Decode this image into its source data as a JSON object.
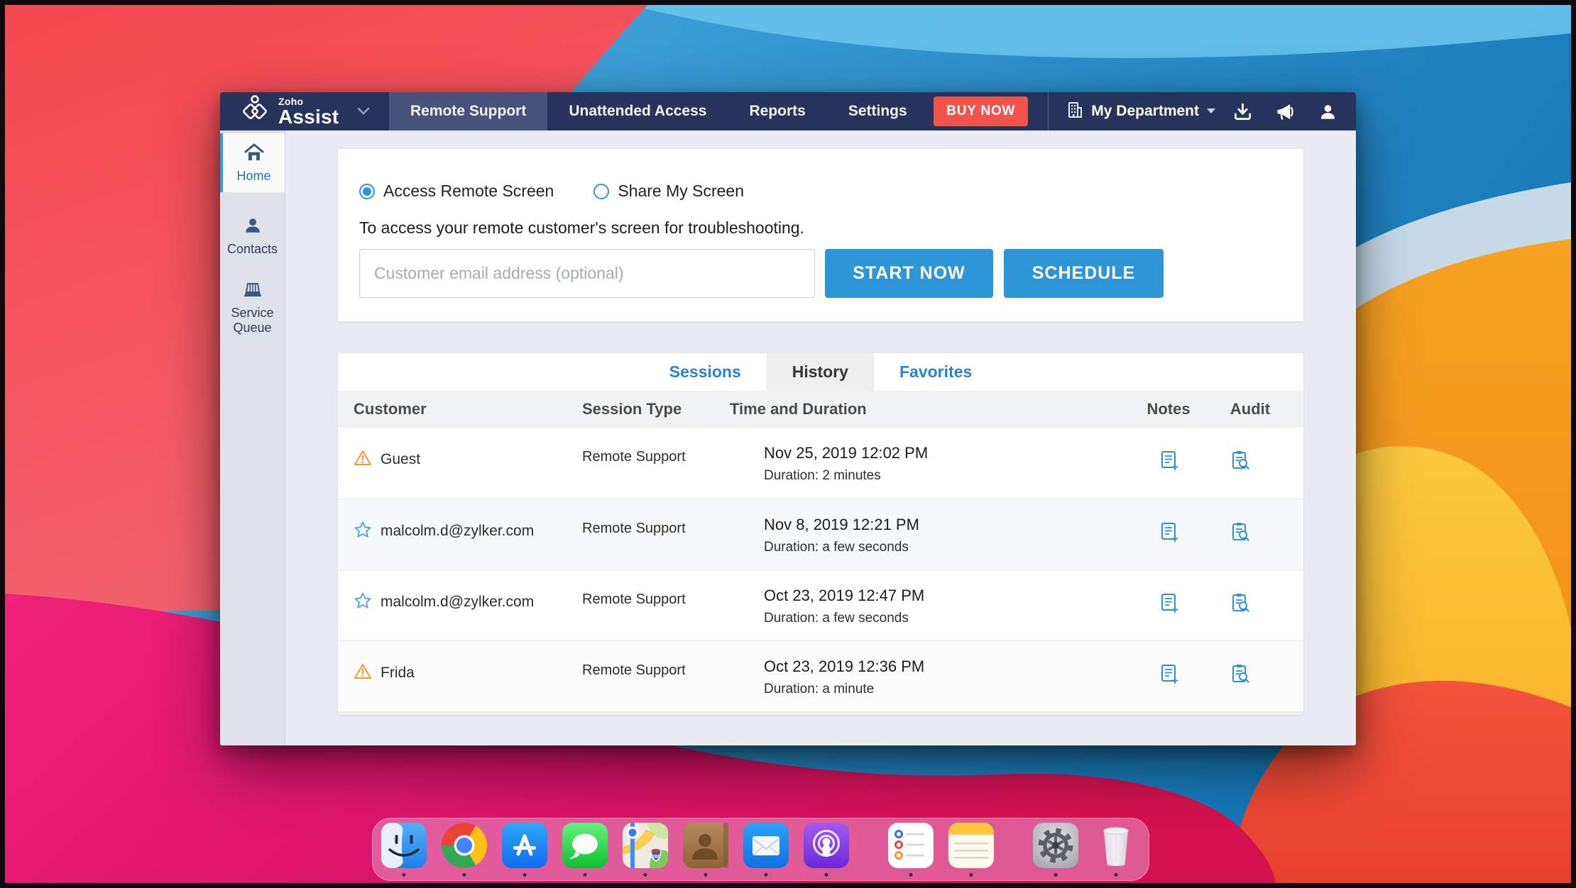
{
  "window": {
    "nav": {
      "brand": {
        "top": "Zoho",
        "bottom": "Assist"
      },
      "tabs": [
        {
          "label": "Remote Support",
          "active": true
        },
        {
          "label": "Unattended Access",
          "active": false
        },
        {
          "label": "Reports",
          "active": false
        },
        {
          "label": "Settings",
          "active": false
        }
      ],
      "buy_now": "BUY NOW",
      "department": "My Department"
    },
    "sidebar": {
      "items": [
        {
          "label": "Home",
          "active": true
        },
        {
          "label": "Contacts",
          "active": false
        },
        {
          "label": "Service Queue",
          "active": false
        }
      ]
    },
    "session_panel": {
      "radios": [
        {
          "label": "Access Remote Screen",
          "selected": true
        },
        {
          "label": "Share My Screen",
          "selected": false
        }
      ],
      "description": "To access your remote customer's screen for troubleshooting.",
      "email_placeholder": "Customer email address (optional)",
      "start_button": "START NOW",
      "schedule_button": "SCHEDULE"
    },
    "history_panel": {
      "tabs": [
        {
          "label": "Sessions",
          "active": false
        },
        {
          "label": "History",
          "active": true
        },
        {
          "label": "Favorites",
          "active": false
        }
      ],
      "columns": [
        "Customer",
        "Session Type",
        "Time and Duration",
        "Notes",
        "Audit"
      ],
      "rows": [
        {
          "status_icon": "warning-icon",
          "customer": "Guest",
          "session_type": "Remote Support",
          "time": "Nov 25, 2019 12:02 PM",
          "duration": "Duration: 2 minutes"
        },
        {
          "status_icon": "star-icon",
          "customer": "malcolm.d@zylker.com",
          "session_type": "Remote Support",
          "time": "Nov 8, 2019 12:21 PM",
          "duration": "Duration: a few seconds"
        },
        {
          "status_icon": "star-icon",
          "customer": "malcolm.d@zylker.com",
          "session_type": "Remote Support",
          "time": "Oct 23, 2019 12:47 PM",
          "duration": "Duration: a few seconds"
        },
        {
          "status_icon": "warning-icon",
          "customer": "Frida",
          "session_type": "Remote Support",
          "time": "Oct 23, 2019 12:36 PM",
          "duration": "Duration: a minute"
        }
      ]
    }
  },
  "dock": {
    "apps": [
      {
        "name": "finder-icon"
      },
      {
        "name": "chrome-icon"
      },
      {
        "name": "app-store-icon"
      },
      {
        "name": "messages-icon"
      },
      {
        "name": "maps-icon"
      },
      {
        "name": "contacts-icon"
      },
      {
        "name": "mail-icon"
      },
      {
        "name": "podcasts-icon"
      },
      {
        "name": "reminders-icon"
      },
      {
        "name": "notes-icon"
      },
      {
        "name": "system-preferences-icon"
      },
      {
        "name": "trash-icon"
      }
    ]
  },
  "colors": {
    "nav_bg": "#26335B",
    "nav_active_tab": "#45537B",
    "accent_blue": "#2E95D7",
    "link_blue": "#2B84CA",
    "buy_now_red": "#F0544A",
    "warning_orange": "#F09A36",
    "star_blue": "#58A7E3",
    "sidebar_bg": "#DFE2E8",
    "content_bg": "#E9ECF3"
  }
}
